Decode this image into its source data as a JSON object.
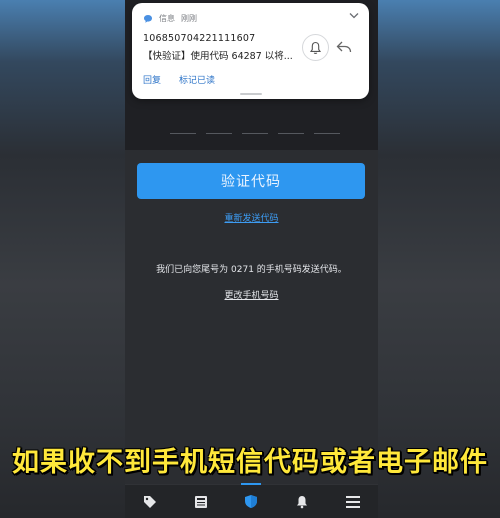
{
  "notification": {
    "app_name": "信息",
    "time": "刚刚",
    "sender": "106850704221111607",
    "body": "【快验证】使用代码 64287 以将...",
    "actions": [
      "回复",
      "标记已读"
    ]
  },
  "screen": {
    "verify_button": "验证代码",
    "resend_link": "重新发送代码",
    "info_text": "我们已向您尾号为 0271 的手机号码发送代码。",
    "change_number_link": "更改手机号码"
  },
  "bottom_nav": {
    "items": [
      "tag-icon",
      "news-icon",
      "shield-icon",
      "bell-icon",
      "menu-icon"
    ],
    "active": "shield-icon"
  },
  "subtitle": "如果收不到手机短信代码或者电子邮件",
  "colors": {
    "accent": "#2e97f0",
    "subtitle": "#ffe83a",
    "link": "#3d9cf3"
  }
}
